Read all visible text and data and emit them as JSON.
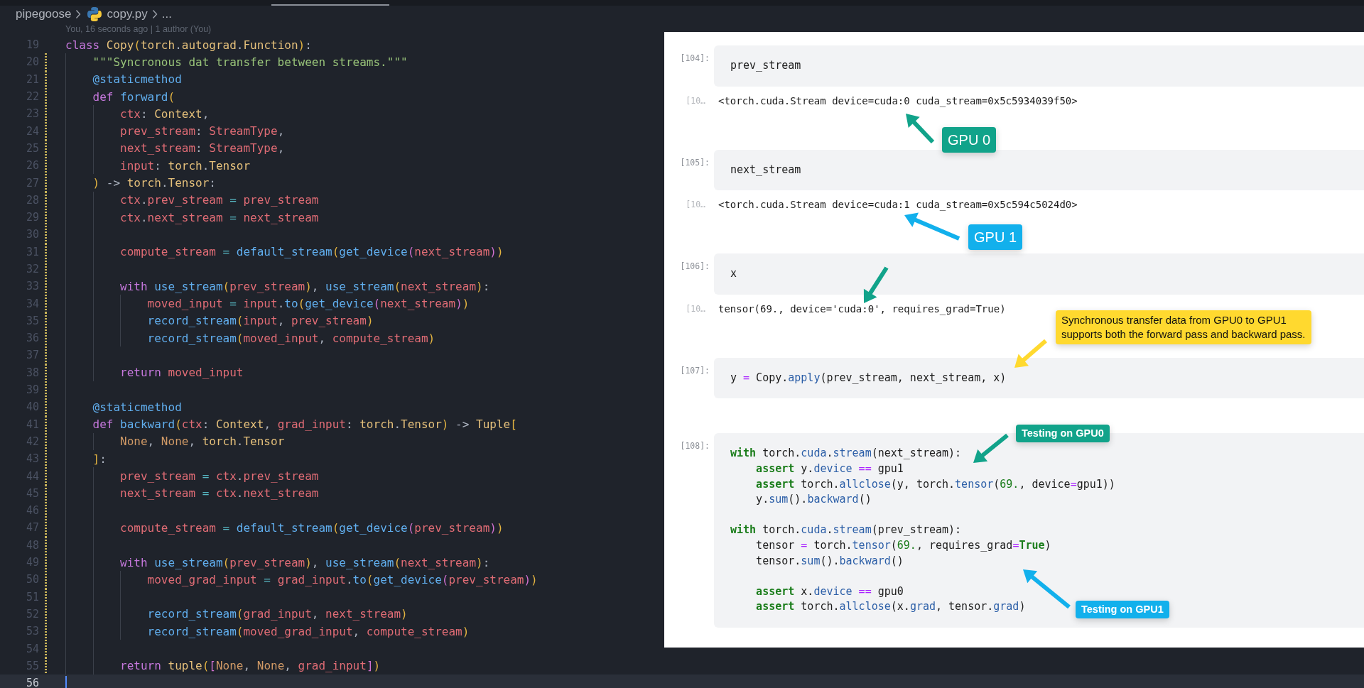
{
  "breadcrumb": {
    "folder": "pipegoose",
    "file": "copy.py",
    "more": "..."
  },
  "blame": "You, 16 seconds ago | 1 author (You)",
  "editor": {
    "lines": [
      {
        "number": "19",
        "modified": false,
        "current": false,
        "tokens": [
          {
            "kind": "k",
            "text": "class "
          },
          {
            "kind": "t",
            "text": "Copy"
          },
          {
            "kind": "b1",
            "text": "("
          },
          {
            "kind": "t",
            "text": "torch"
          },
          {
            "kind": "p",
            "text": "."
          },
          {
            "kind": "t",
            "text": "autograd"
          },
          {
            "kind": "p",
            "text": "."
          },
          {
            "kind": "t",
            "text": "Function"
          },
          {
            "kind": "b1",
            "text": ")"
          },
          {
            "kind": "p",
            "text": ":"
          }
        ]
      },
      {
        "number": "20",
        "modified": true,
        "current": false,
        "tokens": [
          {
            "kind": "s",
            "text": "    \"\"\"Syncronous dat transfer between streams.\"\"\""
          }
        ]
      },
      {
        "number": "21",
        "modified": true,
        "current": false,
        "tokens": [
          {
            "kind": "f",
            "text": "    @staticmethod"
          }
        ]
      },
      {
        "number": "22",
        "modified": true,
        "current": false,
        "tokens": [
          {
            "kind": "k",
            "text": "    def "
          },
          {
            "kind": "f",
            "text": "forward"
          },
          {
            "kind": "b1",
            "text": "("
          }
        ]
      },
      {
        "number": "23",
        "modified": true,
        "current": false,
        "tokens": [
          {
            "kind": "v",
            "text": "        ctx"
          },
          {
            "kind": "p",
            "text": ": "
          },
          {
            "kind": "t",
            "text": "Context"
          },
          {
            "kind": "p",
            "text": ","
          }
        ]
      },
      {
        "number": "24",
        "modified": true,
        "current": false,
        "tokens": [
          {
            "kind": "v",
            "text": "        prev_stream"
          },
          {
            "kind": "p",
            "text": ": "
          },
          {
            "kind": "v",
            "text": "StreamType"
          },
          {
            "kind": "p",
            "text": ","
          }
        ]
      },
      {
        "number": "25",
        "modified": true,
        "current": false,
        "tokens": [
          {
            "kind": "v",
            "text": "        next_stream"
          },
          {
            "kind": "p",
            "text": ": "
          },
          {
            "kind": "v",
            "text": "StreamType"
          },
          {
            "kind": "p",
            "text": ","
          }
        ]
      },
      {
        "number": "26",
        "modified": true,
        "current": false,
        "tokens": [
          {
            "kind": "v",
            "text": "        input"
          },
          {
            "kind": "p",
            "text": ": "
          },
          {
            "kind": "t",
            "text": "torch"
          },
          {
            "kind": "p",
            "text": "."
          },
          {
            "kind": "t",
            "text": "Tensor"
          }
        ]
      },
      {
        "number": "27",
        "modified": true,
        "current": false,
        "tokens": [
          {
            "kind": "b1",
            "text": "    )"
          },
          {
            "kind": "p",
            "text": " -> "
          },
          {
            "kind": "t",
            "text": "torch"
          },
          {
            "kind": "p",
            "text": "."
          },
          {
            "kind": "t",
            "text": "Tensor"
          },
          {
            "kind": "p",
            "text": ":"
          }
        ]
      },
      {
        "number": "28",
        "modified": true,
        "current": false,
        "tokens": [
          {
            "kind": "v",
            "text": "        ctx"
          },
          {
            "kind": "p",
            "text": "."
          },
          {
            "kind": "v",
            "text": "prev_stream"
          },
          {
            "kind": "o",
            "text": " = "
          },
          {
            "kind": "v",
            "text": "prev_stream"
          }
        ]
      },
      {
        "number": "29",
        "modified": true,
        "current": false,
        "tokens": [
          {
            "kind": "v",
            "text": "        ctx"
          },
          {
            "kind": "p",
            "text": "."
          },
          {
            "kind": "v",
            "text": "next_stream"
          },
          {
            "kind": "o",
            "text": " = "
          },
          {
            "kind": "v",
            "text": "next_stream"
          }
        ]
      },
      {
        "number": "30",
        "modified": true,
        "current": false
      },
      {
        "number": "31",
        "modified": true,
        "current": false,
        "tokens": [
          {
            "kind": "v",
            "text": "        compute_stream"
          },
          {
            "kind": "o",
            "text": " = "
          },
          {
            "kind": "f",
            "text": "default_stream"
          },
          {
            "kind": "b1",
            "text": "("
          },
          {
            "kind": "f",
            "text": "get_device"
          },
          {
            "kind": "b2",
            "text": "("
          },
          {
            "kind": "v",
            "text": "next_stream"
          },
          {
            "kind": "b2",
            "text": ")"
          },
          {
            "kind": "b1",
            "text": ")"
          }
        ]
      },
      {
        "number": "32",
        "modified": true,
        "current": false
      },
      {
        "number": "33",
        "modified": true,
        "current": false,
        "tokens": [
          {
            "kind": "k",
            "text": "        with "
          },
          {
            "kind": "f",
            "text": "use_stream"
          },
          {
            "kind": "b1",
            "text": "("
          },
          {
            "kind": "v",
            "text": "prev_stream"
          },
          {
            "kind": "b1",
            "text": ")"
          },
          {
            "kind": "p",
            "text": ", "
          },
          {
            "kind": "f",
            "text": "use_stream"
          },
          {
            "kind": "b1",
            "text": "("
          },
          {
            "kind": "v",
            "text": "next_stream"
          },
          {
            "kind": "b1",
            "text": ")"
          },
          {
            "kind": "p",
            "text": ":"
          }
        ]
      },
      {
        "number": "34",
        "modified": true,
        "current": false,
        "tokens": [
          {
            "kind": "v",
            "text": "            moved_input"
          },
          {
            "kind": "o",
            "text": " = "
          },
          {
            "kind": "v",
            "text": "input"
          },
          {
            "kind": "p",
            "text": "."
          },
          {
            "kind": "f",
            "text": "to"
          },
          {
            "kind": "b1",
            "text": "("
          },
          {
            "kind": "f",
            "text": "get_device"
          },
          {
            "kind": "b2",
            "text": "("
          },
          {
            "kind": "v",
            "text": "next_stream"
          },
          {
            "kind": "b2",
            "text": ")"
          },
          {
            "kind": "b1",
            "text": ")"
          }
        ]
      },
      {
        "number": "35",
        "modified": true,
        "current": false,
        "tokens": [
          {
            "kind": "f",
            "text": "            record_stream"
          },
          {
            "kind": "b1",
            "text": "("
          },
          {
            "kind": "v",
            "text": "input"
          },
          {
            "kind": "p",
            "text": ", "
          },
          {
            "kind": "v",
            "text": "prev_stream"
          },
          {
            "kind": "b1",
            "text": ")"
          }
        ]
      },
      {
        "number": "36",
        "modified": true,
        "current": false,
        "tokens": [
          {
            "kind": "f",
            "text": "            record_stream"
          },
          {
            "kind": "b1",
            "text": "("
          },
          {
            "kind": "v",
            "text": "moved_input"
          },
          {
            "kind": "p",
            "text": ", "
          },
          {
            "kind": "v",
            "text": "compute_stream"
          },
          {
            "kind": "b1",
            "text": ")"
          }
        ]
      },
      {
        "number": "37",
        "modified": true,
        "current": false
      },
      {
        "number": "38",
        "modified": true,
        "current": false,
        "tokens": [
          {
            "kind": "k",
            "text": "        return "
          },
          {
            "kind": "v",
            "text": "moved_input"
          }
        ]
      },
      {
        "number": "39",
        "modified": true,
        "current": false
      },
      {
        "number": "40",
        "modified": true,
        "current": false,
        "tokens": [
          {
            "kind": "f",
            "text": "    @staticmethod"
          }
        ]
      },
      {
        "number": "41",
        "modified": true,
        "current": false,
        "tokens": [
          {
            "kind": "k",
            "text": "    def "
          },
          {
            "kind": "f",
            "text": "backward"
          },
          {
            "kind": "b1",
            "text": "("
          },
          {
            "kind": "v",
            "text": "ctx"
          },
          {
            "kind": "p",
            "text": ": "
          },
          {
            "kind": "t",
            "text": "Context"
          },
          {
            "kind": "p",
            "text": ", "
          },
          {
            "kind": "v",
            "text": "grad_input"
          },
          {
            "kind": "p",
            "text": ": "
          },
          {
            "kind": "t",
            "text": "torch"
          },
          {
            "kind": "p",
            "text": "."
          },
          {
            "kind": "t",
            "text": "Tensor"
          },
          {
            "kind": "b1",
            "text": ")"
          },
          {
            "kind": "p",
            "text": " -> "
          },
          {
            "kind": "t",
            "text": "Tuple"
          },
          {
            "kind": "b1",
            "text": "["
          }
        ]
      },
      {
        "number": "42",
        "modified": true,
        "current": false,
        "tokens": [
          {
            "kind": "n",
            "text": "        None"
          },
          {
            "kind": "p",
            "text": ", "
          },
          {
            "kind": "n",
            "text": "None"
          },
          {
            "kind": "p",
            "text": ", "
          },
          {
            "kind": "t",
            "text": "torch"
          },
          {
            "kind": "p",
            "text": "."
          },
          {
            "kind": "t",
            "text": "Tensor"
          }
        ]
      },
      {
        "number": "43",
        "modified": true,
        "current": false,
        "tokens": [
          {
            "kind": "b1",
            "text": "    ]"
          },
          {
            "kind": "p",
            "text": ":"
          }
        ]
      },
      {
        "number": "44",
        "modified": true,
        "current": false,
        "tokens": [
          {
            "kind": "v",
            "text": "        prev_stream"
          },
          {
            "kind": "o",
            "text": " = "
          },
          {
            "kind": "v",
            "text": "ctx"
          },
          {
            "kind": "p",
            "text": "."
          },
          {
            "kind": "v",
            "text": "prev_stream"
          }
        ]
      },
      {
        "number": "45",
        "modified": true,
        "current": false,
        "tokens": [
          {
            "kind": "v",
            "text": "        next_stream"
          },
          {
            "kind": "o",
            "text": " = "
          },
          {
            "kind": "v",
            "text": "ctx"
          },
          {
            "kind": "p",
            "text": "."
          },
          {
            "kind": "v",
            "text": "next_stream"
          }
        ]
      },
      {
        "number": "46",
        "modified": true,
        "current": false
      },
      {
        "number": "47",
        "modified": true,
        "current": false,
        "tokens": [
          {
            "kind": "v",
            "text": "        compute_stream"
          },
          {
            "kind": "o",
            "text": " = "
          },
          {
            "kind": "f",
            "text": "default_stream"
          },
          {
            "kind": "b1",
            "text": "("
          },
          {
            "kind": "f",
            "text": "get_device"
          },
          {
            "kind": "b2",
            "text": "("
          },
          {
            "kind": "v",
            "text": "prev_stream"
          },
          {
            "kind": "b2",
            "text": ")"
          },
          {
            "kind": "b1",
            "text": ")"
          }
        ]
      },
      {
        "number": "48",
        "modified": true,
        "current": false
      },
      {
        "number": "49",
        "modified": true,
        "current": false,
        "tokens": [
          {
            "kind": "k",
            "text": "        with "
          },
          {
            "kind": "f",
            "text": "use_stream"
          },
          {
            "kind": "b1",
            "text": "("
          },
          {
            "kind": "v",
            "text": "prev_stream"
          },
          {
            "kind": "b1",
            "text": ")"
          },
          {
            "kind": "p",
            "text": ", "
          },
          {
            "kind": "f",
            "text": "use_stream"
          },
          {
            "kind": "b1",
            "text": "("
          },
          {
            "kind": "v",
            "text": "next_stream"
          },
          {
            "kind": "b1",
            "text": ")"
          },
          {
            "kind": "p",
            "text": ":"
          }
        ]
      },
      {
        "number": "50",
        "modified": true,
        "current": false,
        "tokens": [
          {
            "kind": "v",
            "text": "            moved_grad_input"
          },
          {
            "kind": "o",
            "text": " = "
          },
          {
            "kind": "v",
            "text": "grad_input"
          },
          {
            "kind": "p",
            "text": "."
          },
          {
            "kind": "f",
            "text": "to"
          },
          {
            "kind": "b1",
            "text": "("
          },
          {
            "kind": "f",
            "text": "get_device"
          },
          {
            "kind": "b2",
            "text": "("
          },
          {
            "kind": "v",
            "text": "prev_stream"
          },
          {
            "kind": "b2",
            "text": ")"
          },
          {
            "kind": "b1",
            "text": ")"
          }
        ]
      },
      {
        "number": "51",
        "modified": true,
        "current": false
      },
      {
        "number": "52",
        "modified": true,
        "current": false,
        "tokens": [
          {
            "kind": "f",
            "text": "            record_stream"
          },
          {
            "kind": "b1",
            "text": "("
          },
          {
            "kind": "v",
            "text": "grad_input"
          },
          {
            "kind": "p",
            "text": ", "
          },
          {
            "kind": "v",
            "text": "next_stream"
          },
          {
            "kind": "b1",
            "text": ")"
          }
        ]
      },
      {
        "number": "53",
        "modified": true,
        "current": false,
        "tokens": [
          {
            "kind": "f",
            "text": "            record_stream"
          },
          {
            "kind": "b1",
            "text": "("
          },
          {
            "kind": "v",
            "text": "moved_grad_input"
          },
          {
            "kind": "p",
            "text": ", "
          },
          {
            "kind": "v",
            "text": "compute_stream"
          },
          {
            "kind": "b1",
            "text": ")"
          }
        ]
      },
      {
        "number": "54",
        "modified": true,
        "current": false
      },
      {
        "number": "55",
        "modified": true,
        "current": false,
        "tokens": [
          {
            "kind": "k",
            "text": "        return "
          },
          {
            "kind": "t",
            "text": "tuple"
          },
          {
            "kind": "b1",
            "text": "("
          },
          {
            "kind": "b2",
            "text": "["
          },
          {
            "kind": "n",
            "text": "None"
          },
          {
            "kind": "p",
            "text": ", "
          },
          {
            "kind": "n",
            "text": "None"
          },
          {
            "kind": "p",
            "text": ", "
          },
          {
            "kind": "v",
            "text": "grad_input"
          },
          {
            "kind": "b2",
            "text": "]"
          },
          {
            "kind": "b1",
            "text": ")"
          }
        ]
      },
      {
        "number": "56",
        "modified": false,
        "current": true
      }
    ]
  },
  "notebook": {
    "cells": [
      {
        "prompt": "[104]:",
        "code": [
          {
            "kind": "code",
            "tokens": [
              {
                "kind": "n",
                "text": "prev_stream"
              }
            ]
          }
        ],
        "output": {
          "prompt": "[10…",
          "text": "<torch.cuda.Stream device=cuda:0 cuda_stream=0x5c5934039f50>"
        }
      },
      {
        "prompt": "[105]:",
        "code": [
          {
            "kind": "code",
            "tokens": [
              {
                "kind": "n",
                "text": "next_stream"
              }
            ]
          }
        ],
        "output": {
          "prompt": "[10…",
          "text": "<torch.cuda.Stream device=cuda:1 cuda_stream=0x5c594c5024d0>"
        }
      },
      {
        "prompt": "[106]:",
        "code": [
          {
            "kind": "code",
            "tokens": [
              {
                "kind": "n",
                "text": "x"
              }
            ]
          }
        ],
        "output": {
          "prompt": "[10…",
          "text": "tensor(69., device='cuda:0', requires_grad=True)"
        }
      },
      {
        "prompt": "[107]:",
        "code": [
          {
            "kind": "code",
            "tokens": [
              {
                "kind": "n",
                "text": "y "
              },
              {
                "kind": "o",
                "text": "="
              },
              {
                "kind": "n",
                "text": " Copy."
              },
              {
                "kind": "a",
                "text": "apply"
              },
              {
                "kind": "n",
                "text": "(prev_stream, next_stream, x)"
              }
            ]
          }
        ]
      },
      {
        "prompt": "[108]:",
        "code": [
          {
            "kind": "code",
            "tokens": [
              {
                "kind": "k",
                "text": "with"
              },
              {
                "kind": "n",
                "text": " torch."
              },
              {
                "kind": "a",
                "text": "cuda"
              },
              {
                "kind": "n",
                "text": "."
              },
              {
                "kind": "a",
                "text": "stream"
              },
              {
                "kind": "n",
                "text": "(next_stream):"
              }
            ]
          },
          {
            "kind": "code",
            "tokens": [
              {
                "kind": "k",
                "text": "    assert"
              },
              {
                "kind": "n",
                "text": " y."
              },
              {
                "kind": "a",
                "text": "device"
              },
              {
                "kind": "o",
                "text": " =="
              },
              {
                "kind": "n",
                "text": " gpu1"
              }
            ]
          },
          {
            "kind": "code",
            "tokens": [
              {
                "kind": "k",
                "text": "    assert"
              },
              {
                "kind": "n",
                "text": " torch."
              },
              {
                "kind": "a",
                "text": "allclose"
              },
              {
                "kind": "n",
                "text": "(y, torch."
              },
              {
                "kind": "a",
                "text": "tensor"
              },
              {
                "kind": "n",
                "text": "("
              },
              {
                "kind": "m",
                "text": "69."
              },
              {
                "kind": "n",
                "text": ", device"
              },
              {
                "kind": "o",
                "text": "="
              },
              {
                "kind": "n",
                "text": "gpu1))"
              }
            ]
          },
          {
            "kind": "code",
            "tokens": [
              {
                "kind": "n",
                "text": "    y."
              },
              {
                "kind": "a",
                "text": "sum"
              },
              {
                "kind": "n",
                "text": "()."
              },
              {
                "kind": "a",
                "text": "backward"
              },
              {
                "kind": "n",
                "text": "()"
              }
            ]
          },
          {
            "kind": "blank"
          },
          {
            "kind": "code",
            "tokens": [
              {
                "kind": "k",
                "text": "with"
              },
              {
                "kind": "n",
                "text": " torch."
              },
              {
                "kind": "a",
                "text": "cuda"
              },
              {
                "kind": "n",
                "text": "."
              },
              {
                "kind": "a",
                "text": "stream"
              },
              {
                "kind": "n",
                "text": "(prev_stream):"
              }
            ]
          },
          {
            "kind": "code",
            "tokens": [
              {
                "kind": "n",
                "text": "    tensor "
              },
              {
                "kind": "o",
                "text": "="
              },
              {
                "kind": "n",
                "text": " torch."
              },
              {
                "kind": "a",
                "text": "tensor"
              },
              {
                "kind": "n",
                "text": "("
              },
              {
                "kind": "m",
                "text": "69."
              },
              {
                "kind": "n",
                "text": ", requires_grad"
              },
              {
                "kind": "o",
                "text": "="
              },
              {
                "kind": "k",
                "text": "True"
              },
              {
                "kind": "n",
                "text": ")"
              }
            ]
          },
          {
            "kind": "code",
            "tokens": [
              {
                "kind": "n",
                "text": "    tensor."
              },
              {
                "kind": "a",
                "text": "sum"
              },
              {
                "kind": "n",
                "text": "()."
              },
              {
                "kind": "a",
                "text": "backward"
              },
              {
                "kind": "n",
                "text": "()"
              }
            ]
          },
          {
            "kind": "blank"
          },
          {
            "kind": "code",
            "tokens": [
              {
                "kind": "k",
                "text": "    assert"
              },
              {
                "kind": "n",
                "text": " x."
              },
              {
                "kind": "a",
                "text": "device"
              },
              {
                "kind": "o",
                "text": " =="
              },
              {
                "kind": "n",
                "text": " gpu0"
              }
            ]
          },
          {
            "kind": "code",
            "tokens": [
              {
                "kind": "k",
                "text": "    assert"
              },
              {
                "kind": "n",
                "text": " torch."
              },
              {
                "kind": "a",
                "text": "allclose"
              },
              {
                "kind": "n",
                "text": "(x."
              },
              {
                "kind": "a",
                "text": "grad"
              },
              {
                "kind": "n",
                "text": ", tensor."
              },
              {
                "kind": "a",
                "text": "grad"
              },
              {
                "kind": "n",
                "text": ")"
              }
            ]
          }
        ]
      }
    ],
    "annotations": [
      {
        "kind": "large",
        "text": "GPU 0",
        "color": "#11a38a"
      },
      {
        "kind": "large",
        "text": "GPU 1",
        "color": "#12b0ec"
      },
      {
        "kind": "note",
        "text": "Synchronous transfer data from GPU0 to GPU1\nsupports both the forward pass and backward pass.",
        "color": "#ffd92f"
      },
      {
        "kind": "small",
        "text": "Testing on GPU0",
        "color": "#11a38a"
      },
      {
        "kind": "small",
        "text": "Testing on GPU1",
        "color": "#12b0ec"
      }
    ],
    "arrows": [
      {
        "color": "#11a38a"
      },
      {
        "color": "#12b0ec"
      },
      {
        "color": "#11a38a"
      },
      {
        "color": "#ffd92f"
      },
      {
        "color": "#11a38a"
      },
      {
        "color": "#12b0ec"
      }
    ]
  }
}
